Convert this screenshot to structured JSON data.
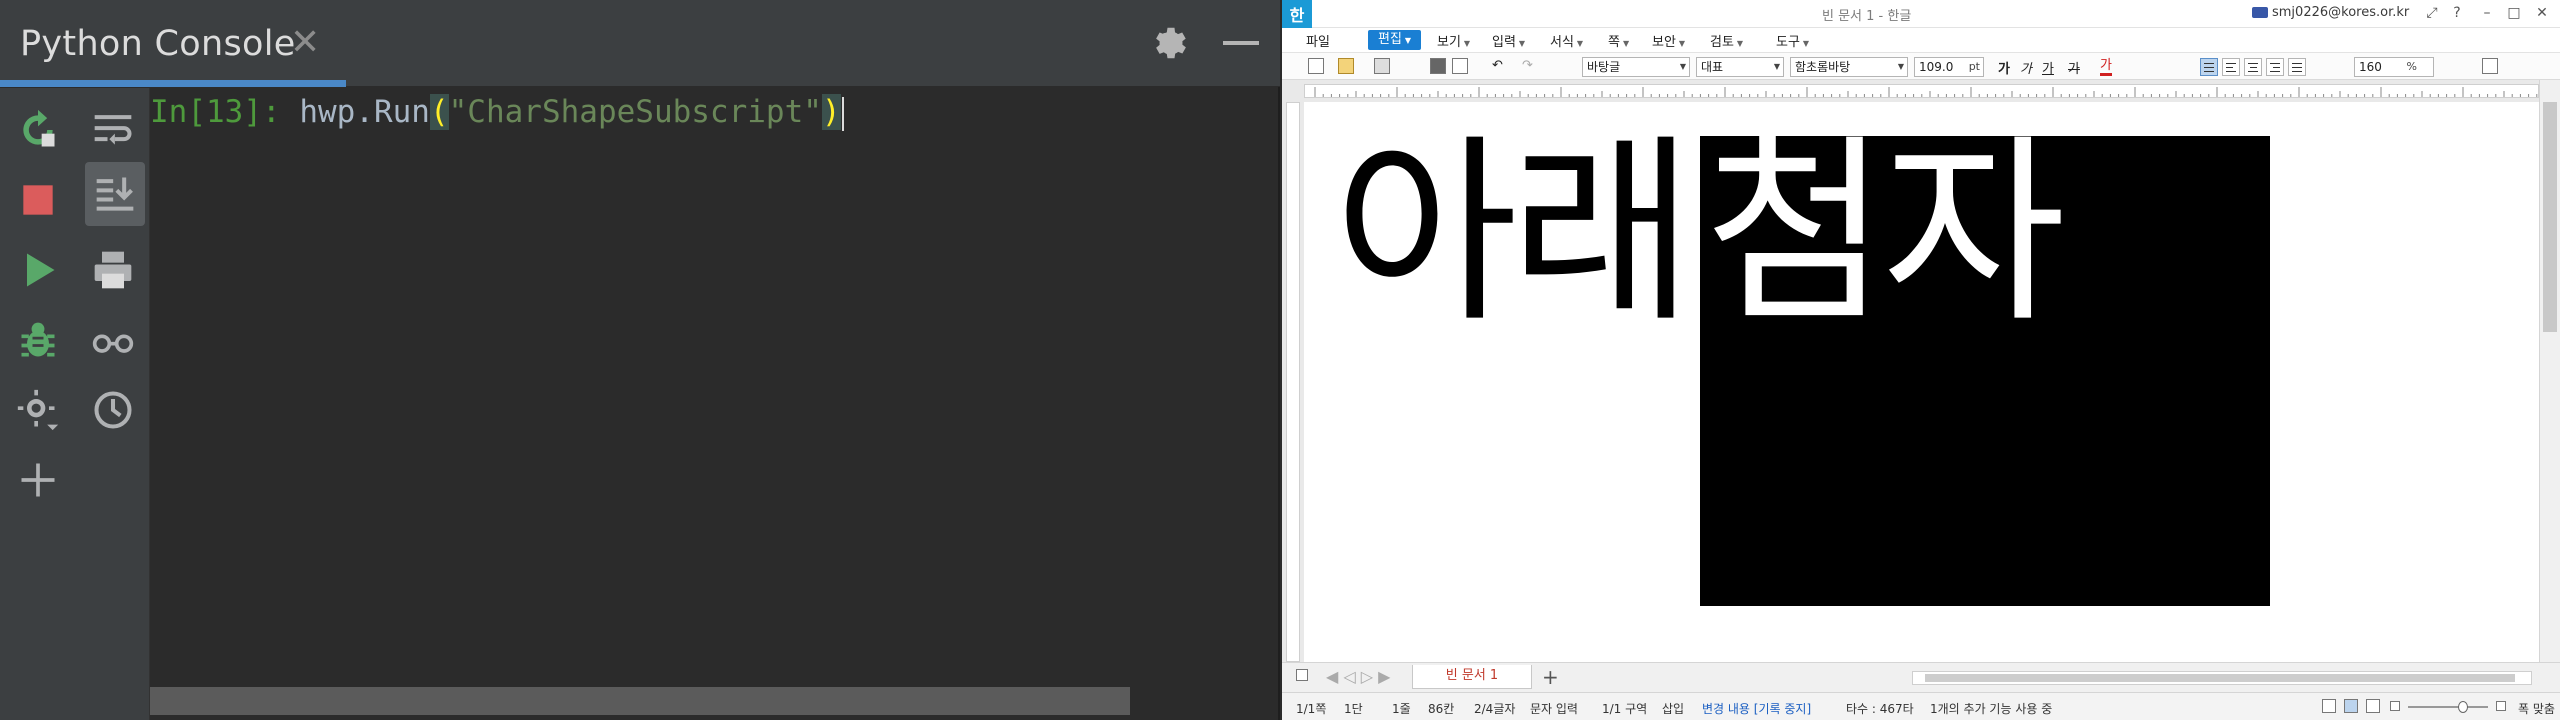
{
  "console": {
    "tab_title": "Python Console",
    "tab_close": "✕",
    "prompt": "In[13]:",
    "code_function": " hwp.Run",
    "open_paren": "(",
    "code_string": "\"CharShapeSubscript\"",
    "close_paren": ")"
  },
  "hwp": {
    "logo": "한",
    "window_title": "빈 문서 1 - 한글",
    "user_email": "smj0226@kores.or.kr",
    "menu": [
      {
        "label": "파일"
      },
      {
        "label": "편집"
      },
      {
        "label": "보기"
      },
      {
        "label": "입력"
      },
      {
        "label": "서식"
      },
      {
        "label": "쪽"
      },
      {
        "label": "보안"
      },
      {
        "label": "검토"
      },
      {
        "label": "도구"
      }
    ],
    "toolbar": {
      "style_combo": "바탕글",
      "lang_combo": "대표",
      "font_combo": "함초롬바탕",
      "font_size": "109.0",
      "size_unit": "pt",
      "bold": "가",
      "italic": "가",
      "underline": "가",
      "strike": "가",
      "color_char": "가",
      "zoom": "160",
      "zoom_unit": "%"
    },
    "document": {
      "normal_text": "아래",
      "selected_text": "첨자"
    },
    "doc_tab": "빈 문서 1",
    "status": {
      "page": "1/1쪽",
      "column": "1단",
      "line": "1줄",
      "cell": "86칸",
      "chars": "2/4글자",
      "input_mode": "문자 입력",
      "section": "1/1 구역",
      "insert": "삽입",
      "track": "변경 내용 [기록 중지]",
      "typing": "타수 : 467타",
      "addons": "1개의 추가 기능 사용 중",
      "fit": "폭 맞춤"
    }
  },
  "colors": {
    "console_bg": "#2b2b2b",
    "prompt_green": "#4e9a3c",
    "string_green": "#6a8759",
    "accent_blue": "#4a88c7",
    "hwp_blue": "#1a7fd3"
  }
}
